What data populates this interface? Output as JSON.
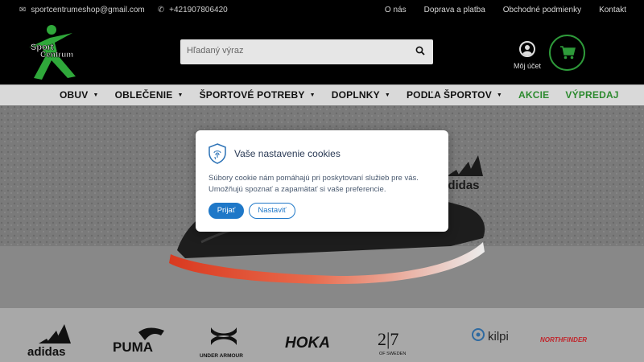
{
  "topbar": {
    "email": "sportcentrumeshop@gmail.com",
    "phone": "+421907806420",
    "links": [
      "O nás",
      "Doprava a platba",
      "Obchodné podmienky",
      "Kontakt"
    ]
  },
  "header": {
    "logo_text_top": "Sport",
    "logo_text_bottom": "Centrum",
    "search_placeholder": "Hľadaný výraz",
    "account_label": "Môj účet"
  },
  "nav": {
    "items": [
      {
        "label": "OBUV",
        "dropdown": true
      },
      {
        "label": "OBLEČENIE",
        "dropdown": true
      },
      {
        "label": "ŠPORTOVÉ POTREBY",
        "dropdown": true
      },
      {
        "label": "DOPLNKY",
        "dropdown": true
      },
      {
        "label": "PODĽA ŠPORTOV",
        "dropdown": true
      },
      {
        "label": "AKCIE",
        "dropdown": false
      },
      {
        "label": "VÝPREDAJ",
        "dropdown": false
      }
    ]
  },
  "hero": {
    "brand_text": "adidas"
  },
  "brands": [
    "adidas",
    "PUMA",
    "UNDER ARMOUR",
    "HOKA",
    "2|7 OF SWEDEN",
    "kilpi",
    "NORTHFINDER"
  ],
  "cookie": {
    "title": "Vaše nastavenie cookies",
    "text_line1": "Súbory cookie nám pomáhajú pri poskytovaní služieb pre vás.",
    "text_line2": "Umožňujú spoznať a zapamätať si vaše preferencie.",
    "accept_label": "Prijať",
    "settings_label": "Nastaviť"
  },
  "colors": {
    "accent_green": "#2e9a3a",
    "button_blue": "#1f78c8",
    "header_bg": "#000000"
  }
}
